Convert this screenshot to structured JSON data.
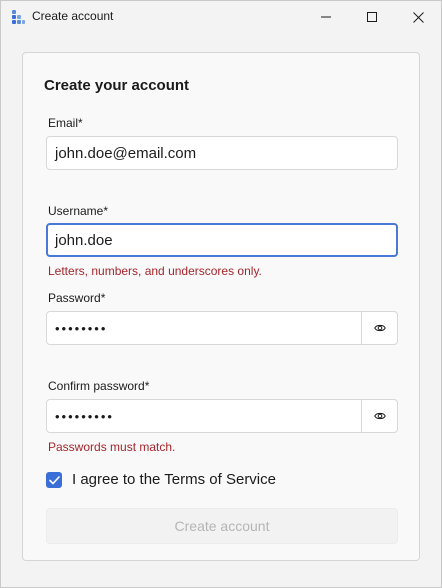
{
  "window": {
    "title": "Create account"
  },
  "form": {
    "heading": "Create your account",
    "email": {
      "label": "Email*",
      "value": "john.doe@email.com"
    },
    "username": {
      "label": "Username*",
      "value": "john.doe",
      "hint": "Letters, numbers, and underscores only."
    },
    "password": {
      "label": "Password*",
      "value": "••••••••"
    },
    "confirm_password": {
      "label": "Confirm password*",
      "value": "•••••••••",
      "error": "Passwords must match."
    },
    "terms": {
      "label": "I agree to the Terms of Service",
      "checked": true
    },
    "submit_label": "Create account"
  },
  "colors": {
    "accent": "#3b6fd8",
    "error": "#a4262c",
    "focus_border": "#4a78d6"
  }
}
